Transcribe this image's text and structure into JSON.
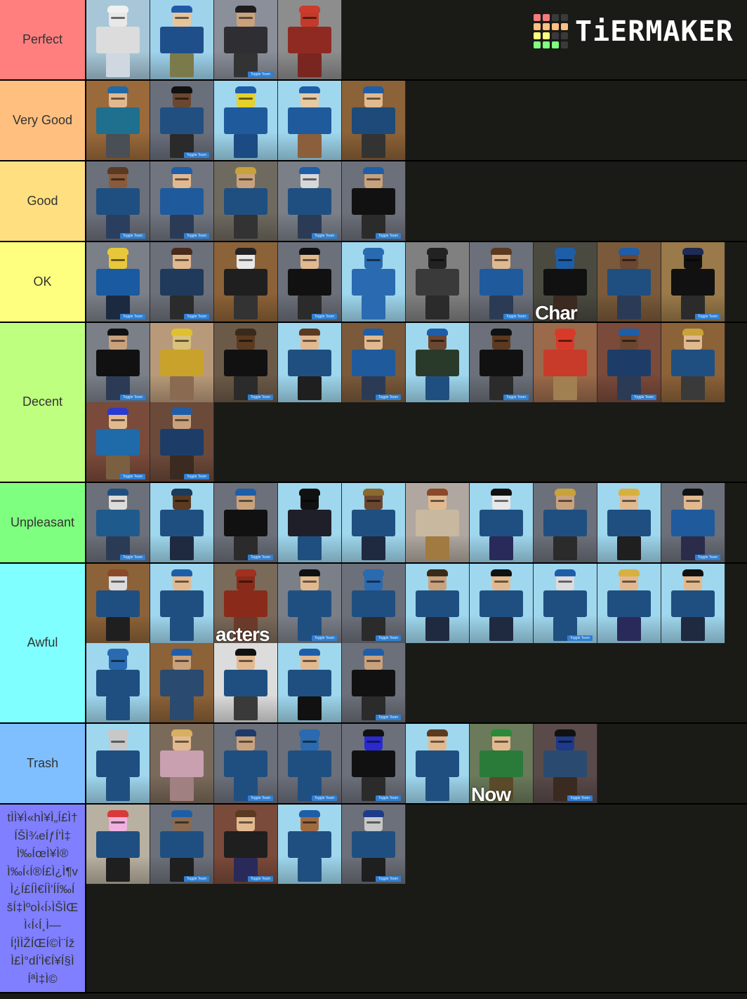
{
  "logo": {
    "text": "TiERMAKER",
    "grid_colors": [
      "#f47c7c",
      "#f47c7c",
      "#3a3a3a",
      "#3a3a3a",
      "#ffbf7f",
      "#ffbf7f",
      "#ffbf7f",
      "#ffbf7f",
      "#ffff7f",
      "#ffff7f",
      "#3a3a3a",
      "#3a3a3a",
      "#7fff7f",
      "#7fff7f",
      "#7fff7f",
      "#3a3a3a"
    ]
  },
  "tiers": [
    {
      "label": "Perfect",
      "color": "#ff7f7f",
      "rows": 1,
      "items": [
        {
          "name": "newspaper-character",
          "bg": "#a7c7d8",
          "head": "#e8e8e8",
          "torso": "#dcdcdc",
          "legs": "#cfd8e0",
          "hat": "#f0f0f0"
        },
        {
          "name": "shotgun-character",
          "bg": "#9fd3ec",
          "head": "#e6c59b",
          "torso": "#1f4f8a",
          "legs": "#7b7a4a",
          "hat": "#1f5aa8"
        },
        {
          "name": "cowboy-character",
          "bg": "#8a8f9a",
          "head": "#c9a27d",
          "torso": "#2e2e33",
          "legs": "#333",
          "hat": "#1d1d1d",
          "toggle": true
        },
        {
          "name": "megaphone-character",
          "bg": "#8d8d8d",
          "head": "#c43a2a",
          "torso": "#8f2a22",
          "legs": "#7a2620",
          "hat": "#cc3b2c"
        }
      ]
    },
    {
      "label": "Very Good",
      "color": "#ffbf7f",
      "rows": 1,
      "items": [
        {
          "name": "sunglasses-cap-character",
          "bg": "#9a6a3a",
          "head": "#e2b98f",
          "torso": "#1f6f8f",
          "legs": "#4a4e55",
          "hat": "#1e6aa8"
        },
        {
          "name": "bowler-hat-character",
          "bg": "#6a6f7c",
          "head": "#6b4630",
          "torso": "#204f80",
          "legs": "#2a2a2a",
          "hat": "#111",
          "toggle": true
        },
        {
          "name": "duck-character",
          "bg": "#9fd7ee",
          "head": "#e6d02a",
          "torso": "#1f5a9c",
          "legs": "#1c4a82",
          "hat": "#1e5ea8"
        },
        {
          "name": "floatie-character",
          "bg": "#9fd7ee",
          "head": "#e8c9a0",
          "torso": "#1f5a9c",
          "legs": "#8b5e3c",
          "hat": "#1e5ea8"
        },
        {
          "name": "bare-arms-character",
          "bg": "#8c6238",
          "head": "#e2b98f",
          "torso": "#1d4a78",
          "legs": "#333",
          "hat": "#1e5ea8"
        }
      ]
    },
    {
      "label": "Good",
      "color": "#ffdf7f",
      "rows": 1,
      "items": [
        {
          "name": "bearded-character",
          "bg": "#6c707a",
          "head": "#8a5a3a",
          "torso": "#1f4f80",
          "legs": "#2a3f5f",
          "hat": "#5b3a20",
          "toggle": true
        },
        {
          "name": "beret-character",
          "bg": "#707580",
          "head": "#e2b98f",
          "torso": "#1f5a9c",
          "legs": "#2b3b55",
          "hat": "#1e5ea8",
          "toggle": true
        },
        {
          "name": "crowned-character",
          "bg": "#6f6a60",
          "head": "#c9a27d",
          "torso": "#1f4f80",
          "legs": "#333",
          "hat": "#c8a23a"
        },
        {
          "name": "wizard-character",
          "bg": "#7a7f88",
          "head": "#d8d8d8",
          "torso": "#1f4f80",
          "legs": "#2b3b55",
          "hat": "#1e5ea8",
          "toggle": true
        },
        {
          "name": "vest-character",
          "bg": "#6c707a",
          "head": "#c9a27d",
          "torso": "#111",
          "legs": "#2b2b2b",
          "hat": "#1e5ea8",
          "toggle": true
        }
      ]
    },
    {
      "label": "OK",
      "color": "#ffff7f",
      "rows": 1,
      "items": [
        {
          "name": "noob-character",
          "bg": "#7a7f88",
          "head": "#e8c83a",
          "torso": "#1a5aa0",
          "legs": "#1c2a40",
          "hat": "#e8c83a",
          "toggle": true
        },
        {
          "name": "strapped-character",
          "bg": "#6c707a",
          "head": "#e2b98f",
          "torso": "#1f3a5a",
          "legs": "#2b2b2b",
          "hat": "#4a2a1a",
          "toggle": true
        },
        {
          "name": "goggles-character",
          "bg": "#8c6238",
          "head": "#e8e8e8",
          "torso": "#1f1f1f",
          "legs": "#333",
          "hat": "#222"
        },
        {
          "name": "headset-character",
          "bg": "#6c707a",
          "head": "#e2b98f",
          "torso": "#111",
          "legs": "#2b2b2b",
          "hat": "#111",
          "toggle": true
        },
        {
          "name": "brick-character",
          "bg": "#9fd7ee",
          "head": "#2a6ab0",
          "torso": "#2a6ab0",
          "legs": "#2a6ab0",
          "hat": "#2a6ab0"
        },
        {
          "name": "balaclava-character",
          "bg": "#808080",
          "head": "#222",
          "torso": "#3a3a3a",
          "legs": "#2b2b2b",
          "hat": "#222"
        },
        {
          "name": "brown-hair-character",
          "bg": "#6c707a",
          "head": "#e2b98f",
          "torso": "#1f5a9c",
          "legs": "#2b3b55",
          "hat": "#5b3a20",
          "toggle": true
        },
        {
          "name": "helmet-camera-character",
          "bg": "#4a4a40",
          "head": "#1e5ea8",
          "torso": "#111",
          "legs": "#3a2a20",
          "hat": "#1e5ea8",
          "overlay": "Char"
        },
        {
          "name": "wide-hat-character",
          "bg": "#7a5a3a",
          "head": "#6b4630",
          "torso": "#1f4f80",
          "legs": "#2b3b55",
          "hat": "#1e5ea8"
        },
        {
          "name": "riot-goggles-character",
          "bg": "#9a7a4a",
          "head": "#111",
          "torso": "#111",
          "legs": "#2b2b2b",
          "hat": "#1f2a55",
          "toggle": true
        }
      ]
    },
    {
      "label": "Decent",
      "color": "#bfff7f",
      "rows": 2,
      "items": [
        {
          "name": "shades-headset-character",
          "bg": "#7a7f88",
          "head": "#c9a27d",
          "torso": "#111",
          "legs": "#2b3b55",
          "hat": "#111",
          "toggle": true
        },
        {
          "name": "chef-character",
          "bg": "#b89a7a",
          "head": "#d9c27a",
          "torso": "#c8a22a",
          "legs": "#8a6a50",
          "hat": "#e0c030"
        },
        {
          "name": "afro-character",
          "bg": "#6c5a48",
          "head": "#5b3a20",
          "torso": "#111",
          "legs": "#2b2b2b",
          "hat": "#3a2a1a",
          "toggle": true
        },
        {
          "name": "rifle-character",
          "bg": "#9fd7ee",
          "head": "#e2b98f",
          "torso": "#1f4f80",
          "legs": "#1f1f1f",
          "hat": "#5b3a20"
        },
        {
          "name": "cap-smile-character",
          "bg": "#7a5a3a",
          "head": "#e2b98f",
          "torso": "#1f5a9c",
          "legs": "#2b3b55",
          "hat": "#1e5ea8",
          "toggle": true
        },
        {
          "name": "firefighter-character",
          "bg": "#9fd7ee",
          "head": "#6b4630",
          "torso": "#2a3a2a",
          "legs": "#1f4f80",
          "hat": "#1e5ea8"
        },
        {
          "name": "shades-dark-character",
          "bg": "#6c707a",
          "head": "#5b3a20",
          "torso": "#111",
          "legs": "#2b2b2b",
          "hat": "#111",
          "toggle": true
        },
        {
          "name": "helmet-bolva-character",
          "bg": "#9a6a4a",
          "head": "#d83a2a",
          "torso": "#c83a2a",
          "legs": "#a08050",
          "hat": "#d83a2a"
        },
        {
          "name": "blue-cap-character",
          "bg": "#7a4a3a",
          "head": "#6b4630",
          "torso": "#1d3d68",
          "legs": "#2b3b55",
          "hat": "#1e5ea8",
          "toggle": true
        },
        {
          "name": "blonde-character",
          "bg": "#8c6238",
          "head": "#e2b98f",
          "torso": "#1f4f80",
          "legs": "#3a3a3a",
          "hat": "#c8a23a"
        },
        {
          "name": "blue-hair-character",
          "bg": "#7a4a3a",
          "head": "#e2b98f",
          "torso": "#1f6aa8",
          "legs": "#7a6040",
          "hat": "#2a3ad0",
          "toggle": true
        },
        {
          "name": "hardhat-beard-character",
          "bg": "#6c4a3a",
          "head": "#c9a27d",
          "torso": "#1d3d68",
          "legs": "#3a2a20",
          "hat": "#1e5ea8",
          "toggle": true
        }
      ]
    },
    {
      "label": "Unpleasant",
      "color": "#7fff7f",
      "rows": 1,
      "items": [
        {
          "name": "skull-mask-character",
          "bg": "#6c707a",
          "head": "#dcdcdc",
          "torso": "#1f5a8c",
          "legs": "#2b3b55",
          "hat": "#1e4f80",
          "toggle": true
        },
        {
          "name": "gunner-cap-character",
          "bg": "#9fd7ee",
          "head": "#5b3a20",
          "torso": "#1f4f80",
          "legs": "#1f2a40",
          "hat": "#1e3a5a"
        },
        {
          "name": "beanie-vest-character",
          "bg": "#6c707a",
          "head": "#c9a27d",
          "torso": "#111",
          "legs": "#2b2b2b",
          "hat": "#1e5ea8",
          "toggle": true
        },
        {
          "name": "armored-character",
          "bg": "#9fd7ee",
          "head": "#111",
          "torso": "#1f1f2a",
          "legs": "#1f4f80",
          "hat": "#111"
        },
        {
          "name": "straw-hat-character",
          "bg": "#9fd7ee",
          "head": "#6b4630",
          "torso": "#1f4f80",
          "legs": "#1f2a40",
          "hat": "#8a6a30"
        },
        {
          "name": "plaid-character",
          "bg": "#b0a8a0",
          "head": "#e2b98f",
          "torso": "#c8b8a0",
          "legs": "#a07a40",
          "hat": "#8a4a2a"
        },
        {
          "name": "sword-character",
          "bg": "#9fd7ee",
          "head": "#e8e8e8",
          "torso": "#1f4f80",
          "legs": "#2a2a5a",
          "hat": "#111"
        },
        {
          "name": "king-character",
          "bg": "#6c707a",
          "head": "#c9a27d",
          "torso": "#1f4f80",
          "legs": "#2b2b2b",
          "hat": "#c8a23a"
        },
        {
          "name": "blonde-gunner-character",
          "bg": "#9fd7ee",
          "head": "#e2b98f",
          "torso": "#1f4f80",
          "legs": "#1f1f1f",
          "hat": "#d8b040"
        },
        {
          "name": "shades-long-hair-character",
          "bg": "#6c707a",
          "head": "#e2b98f",
          "torso": "#1f5a9c",
          "legs": "#2b2b4a",
          "hat": "#111",
          "toggle": true
        }
      ]
    },
    {
      "label": "Awful",
      "color": "#7fffff",
      "rows": 2,
      "items": [
        {
          "name": "headphones-character",
          "bg": "#8c6238",
          "head": "#dcdcdc",
          "torso": "#1f4f80",
          "legs": "#1f1f1f",
          "hat": "#8a4a2a"
        },
        {
          "name": "mustache-character",
          "bg": "#9fd7ee",
          "head": "#e2b98f",
          "torso": "#1f4f80",
          "legs": "#1f4f80",
          "hat": "#1e5ea8"
        },
        {
          "name": "spartan-character",
          "bg": "#7a6a5a",
          "head": "#8a2a1a",
          "torso": "#8a2a1a",
          "legs": "#6a3a2a",
          "hat": "#a03020",
          "overlay": "acters"
        },
        {
          "name": "suit-beard-character",
          "bg": "#7a7f88",
          "head": "#e2b98f",
          "torso": "#1f4f80",
          "legs": "#1f4f80",
          "hat": "#111",
          "toggle": true
        },
        {
          "name": "blue-mask-character",
          "bg": "#6c707a",
          "head": "#2a6ab0",
          "torso": "#1f4f80",
          "legs": "#2b2b2b",
          "hat": "#2a6ab0",
          "toggle": true
        },
        {
          "name": "pistol-cap-character",
          "bg": "#9fd7ee",
          "head": "#c9a27d",
          "torso": "#1f4f80",
          "legs": "#1f2a40",
          "hat": "#3a2a1a"
        },
        {
          "name": "top-hat-character",
          "bg": "#9fd7ee",
          "head": "#e2b98f",
          "torso": "#1f4f80",
          "legs": "#1f2a40",
          "hat": "#111"
        },
        {
          "name": "ninja-character",
          "bg": "#9fd7ee",
          "head": "#dcdcdc",
          "torso": "#1f4f80",
          "legs": "#1f4f80",
          "hat": "#1e5ea8",
          "toggle": true
        },
        {
          "name": "laser-character",
          "bg": "#9fd7ee",
          "head": "#e2b98f",
          "torso": "#1f4f80",
          "legs": "#2a2a5a",
          "hat": "#d8b040"
        },
        {
          "name": "shades-pistol-character",
          "bg": "#9fd7ee",
          "head": "#e2b98f",
          "torso": "#1f4f80",
          "legs": "#1f2a40",
          "hat": "#111"
        },
        {
          "name": "hooded-pistol-character",
          "bg": "#9fd7ee",
          "head": "#2a6ab0",
          "torso": "#1f4f80",
          "legs": "#1f4f80",
          "hat": "#2a6ab0"
        },
        {
          "name": "eyepatch-character",
          "bg": "#8c6238",
          "head": "#c9a27d",
          "torso": "#2a4a70",
          "legs": "#2a4a70",
          "hat": "#1e5ea8"
        },
        {
          "name": "shades-blazer-character",
          "bg": "#dcdcdc",
          "head": "#e2b98f",
          "torso": "#1f4f80",
          "legs": "#3a3a3a",
          "hat": "#111"
        },
        {
          "name": "muscle-beanie-character",
          "bg": "#9fd7ee",
          "head": "#e2b98f",
          "torso": "#1f4f80",
          "legs": "#111",
          "hat": "#1e5ea8"
        },
        {
          "name": "vest-beanie-character",
          "bg": "#6c707a",
          "head": "#c9a27d",
          "torso": "#111",
          "legs": "#2b2b2b",
          "hat": "#1e5ea8",
          "toggle": true
        }
      ]
    },
    {
      "label": "Trash",
      "color": "#7fbfff",
      "rows": 1,
      "items": [
        {
          "name": "alien-character",
          "bg": "#9fd7ee",
          "head": "#c8c8c8",
          "torso": "#1f4f80",
          "legs": "#1f4f80",
          "hat": "#c8c8c8"
        },
        {
          "name": "blonde-curls-character",
          "bg": "#7a6a5a",
          "head": "#e2b98f",
          "torso": "#c8a0b0",
          "legs": "#a08080",
          "hat": "#d8b060"
        },
        {
          "name": "fedora-character",
          "bg": "#6c707a",
          "head": "#c9a27d",
          "torso": "#1f4f80",
          "legs": "#1f4f80",
          "hat": "#1e3a6a",
          "toggle": true
        },
        {
          "name": "blue-hood-character",
          "bg": "#6c707a",
          "head": "#2a6ab0",
          "torso": "#1f4f80",
          "legs": "#1f4f80",
          "hat": "#2a6ab0",
          "toggle": true
        },
        {
          "name": "visor-character",
          "bg": "#6c707a",
          "head": "#2a2ad0",
          "torso": "#111",
          "legs": "#2b2b2b",
          "hat": "#111",
          "toggle": true
        },
        {
          "name": "banana-character",
          "bg": "#9fd7ee",
          "head": "#e2b98f",
          "torso": "#1f4f80",
          "legs": "#1f4f80",
          "hat": "#5b3a20"
        },
        {
          "name": "green-bandana-character",
          "bg": "#6a7a5a",
          "head": "#e2b98f",
          "torso": "#2a7a3a",
          "legs": "#5a4a2a",
          "hat": "#2a8a3a",
          "overlay": "Now"
        },
        {
          "name": "cowgirl-bandana-character",
          "bg": "#5a4a4a",
          "head": "#1e3a8a",
          "torso": "#2a4a70",
          "legs": "#3a2a20",
          "hat": "#111",
          "toggle": true
        }
      ]
    },
    {
      "label": "tìÌ¥Ì«hí¥Ì„í£Ì†íŠÌ¾eíƒí'Ì‡Ì‰íœì¥Ì®Ì‰í‹í®í£Ì¿Ì¶vÌ¿í£íÌ€ííŽÌ'ìí‰íší‡ìºoì‹í›ÌŠÌŒÌ‹í‹í¸Ì—ì¦ÌÌŽíŒí©Ì¨ížÌ£Ì°dí'Ì€í¥í§ÌíªÌ‡Ì©",
      "label_lines": [
        "tÌÌ¥Ì«hÌ¥Ì„Í£Ì†",
        "ÍŠÌ¾eÍƒÍ'Ì‡",
        "Ì‰ÍœÌ¥Ì®",
        "Ì‰Í‹Í®Í£Ì¿Ì¶v",
        "Ì¿Í£ÍÌ€ÍÌ'ÍÍ‰Í",
        "šÍ‡ÌºoÌ‹Í›ÌŠÌŒ",
        "Ì‹Í‹Í¸Ì—",
        "Í¦ÌÌŽÍŒÍ©Ì¨Íž",
        "Ì£Ì°dÍ'Ì€Í¥Í§Ì",
        "ÍªÌ‡Ì©"
      ],
      "color": "#7f7fff",
      "rows": 1,
      "items": [
        {
          "name": "pink-horns-character",
          "bg": "#b8b0a0",
          "head": "#f0b0e0",
          "torso": "#1f4f80",
          "legs": "#1f1f1f",
          "hat": "#d83a3a"
        },
        {
          "name": "tricorn-character",
          "bg": "#6c707a",
          "head": "#8a6a50",
          "torso": "#1f4f80",
          "legs": "#1f1f1f",
          "hat": "#1e5ea8",
          "toggle": true
        },
        {
          "name": "long-coat-character",
          "bg": "#7a4a3a",
          "head": "#e2b98f",
          "torso": "#1f1f1f",
          "legs": "#2a2a5a",
          "hat": "#5b3a20",
          "toggle": true
        },
        {
          "name": "shades-beard-muscle-character",
          "bg": "#9fd7ee",
          "head": "#a06a40",
          "torso": "#1f4f80",
          "legs": "#1f4f80",
          "hat": "#1e5ea8"
        },
        {
          "name": "shark-mask-character",
          "bg": "#6c707a",
          "head": "#c8c8c8",
          "torso": "#1f4f80",
          "legs": "#1f1f1f",
          "hat": "#1e3a8a",
          "toggle": true
        }
      ]
    }
  ],
  "badge_text": "Toggle Team"
}
